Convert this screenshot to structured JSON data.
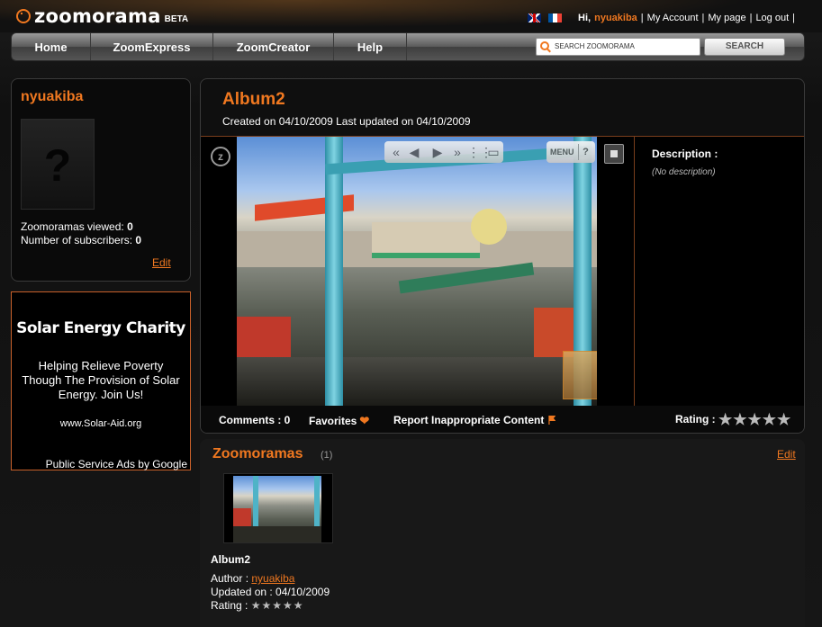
{
  "header": {
    "logo_text": "zoomorama",
    "logo_badge": "BETA",
    "greeting": "Hi,",
    "username": "nyuakiba",
    "links": [
      "My Account",
      "My page",
      "Log out"
    ]
  },
  "nav": {
    "items": [
      "Home",
      "ZoomExpress",
      "ZoomCreator",
      "Help"
    ],
    "search_placeholder": "SEARCH ZOOMORAMA",
    "search_button": "SEARCH"
  },
  "profile": {
    "name": "nyuakiba",
    "avatar_placeholder": "?",
    "viewed_label": "Zoomoramas viewed:",
    "viewed_value": "0",
    "subscribers_label": "Number of subscribers:",
    "subscribers_value": "0",
    "edit": "Edit"
  },
  "ad": {
    "title": "Solar Energy Charity",
    "body": "Helping Relieve Poverty Though The Provision of Solar Energy. Join Us!",
    "url": "www.Solar-Aid.org",
    "footer": "Public Service Ads by Google"
  },
  "album": {
    "title": "Album2",
    "dates": "Created on 04/10/2009 Last updated on 04/10/2009",
    "description_label": "Description :",
    "description_value": "(No description)",
    "menu_label": "MENU",
    "help_label": "?",
    "comments": "Comments : 0",
    "favorites": "Favorites",
    "report": "Report Inappropriate Content",
    "rating_label": "Rating :",
    "rating_value": 0,
    "rating_stars": "★★★★★"
  },
  "zoomoramas": {
    "title": "Zoomoramas",
    "count": "(1)",
    "edit": "Edit",
    "item": {
      "title": "Album2",
      "author_label": "Author :",
      "author": "nyuakiba",
      "updated": "Updated on : 04/10/2009",
      "rating_label": "Rating :",
      "rating_stars": "★★★★★"
    }
  },
  "colors": {
    "accent": "#f07820",
    "background": "#141414"
  }
}
